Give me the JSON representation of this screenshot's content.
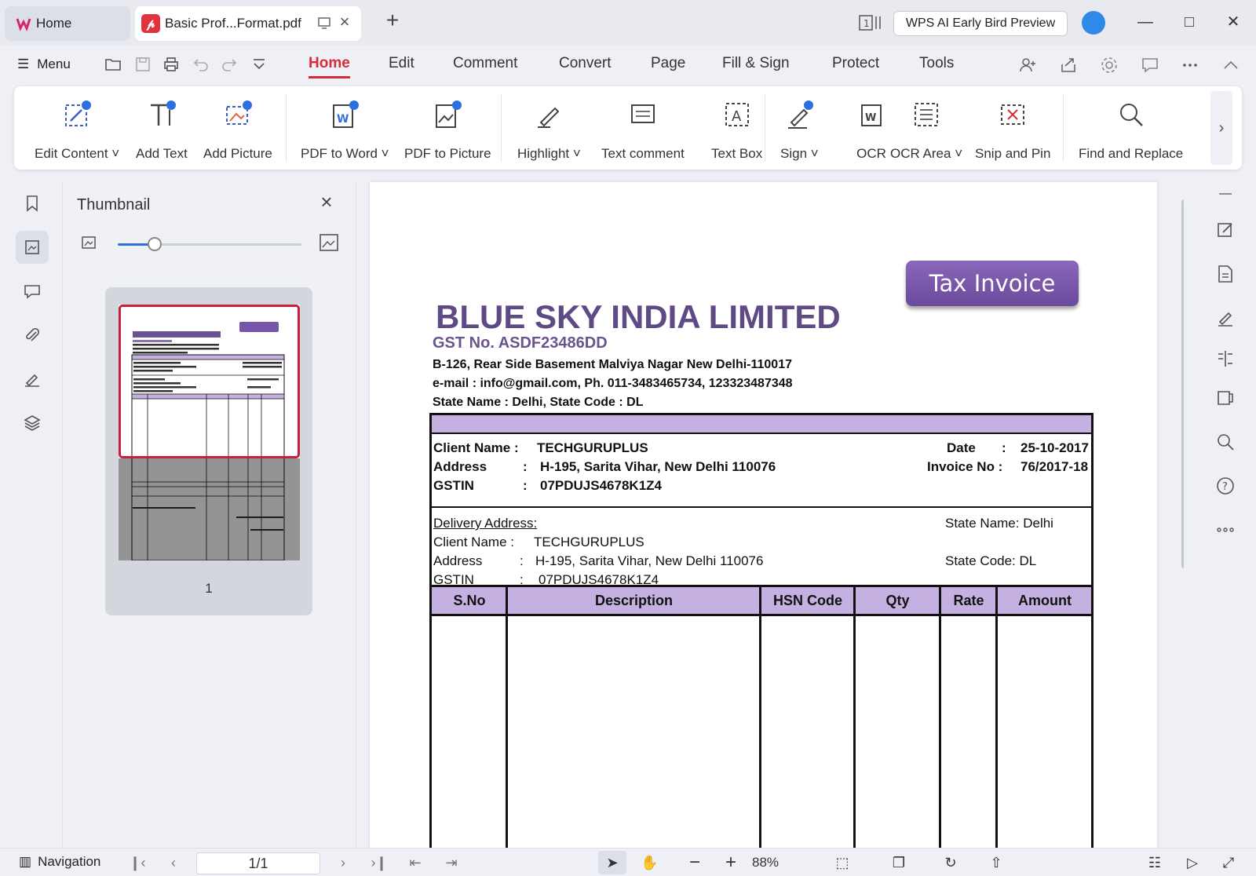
{
  "titlebar": {
    "home_tab": "Home",
    "doc_tab": "Basic Prof...Format.pdf",
    "ai_button": "WPS AI Early Bird Preview"
  },
  "menubar": {
    "menu_label": "Menu",
    "tabs": [
      "Home",
      "Edit",
      "Comment",
      "Convert",
      "Page",
      "Fill & Sign",
      "Protect",
      "Tools"
    ],
    "active_tab": "Home"
  },
  "ribbon": {
    "items": [
      "Edit Content",
      "Add Text",
      "Add Picture",
      "PDF to Word",
      "PDF to Picture",
      "Highlight",
      "Text comment",
      "Text Box",
      "Sign",
      "OCR",
      "OCR Area",
      "Snip and Pin",
      "Find and Replace"
    ],
    "dropdown_mark": "˅"
  },
  "thumbnail": {
    "title": "Thumbnail",
    "page_number": "1",
    "zoom_level": 0.2
  },
  "invoice": {
    "badge": "Tax Invoice",
    "company": "BLUE SKY INDIA LIMITED",
    "gst": "GST No. ASDF23486DD",
    "address": "B-126, Rear Side Basement Malviya Nagar New Delhi-110017",
    "contact": "e-mail : info@gmail.com, Ph. 011-3483465734, 123323487348",
    "state": "State Name : Delhi, State Code : DL",
    "client_label": "Client Name :",
    "client_value": "TECHGURUPLUS",
    "address_label": "Address",
    "address_value": "H-195, Sarita Vihar, New Delhi 110076",
    "gstin_label": "GSTIN",
    "gstin_value": "07PDUJS4678K1Z4",
    "colon": ":",
    "date_label": "Date",
    "date_value": "25-10-2017",
    "invoice_no_label": "Invoice No :",
    "invoice_no_value": "76/2017-18",
    "delivery_heading": "Delivery Address:",
    "delivery_state_name": "State Name: Delhi",
    "delivery_client_label": "Client Name :",
    "delivery_client_value": "TECHGURUPLUS",
    "delivery_address_label": "Address",
    "delivery_address_value": "H-195, Sarita Vihar, New Delhi 110076",
    "delivery_state_code": "State Code: DL",
    "delivery_gstin_label": "GSTIN",
    "delivery_gstin_value": "07PDUJS4678K1Z4",
    "columns": [
      "S.No",
      "Description",
      "HSN Code",
      "Qty",
      "Rate",
      "Amount"
    ]
  },
  "statusbar": {
    "navigation": "Navigation",
    "page_value": "1/1",
    "zoom": "88%"
  },
  "colors": {
    "accent": "#d62b3b",
    "invoice_purple": "#c4b1e1",
    "company_purple": "#5f4a86"
  }
}
